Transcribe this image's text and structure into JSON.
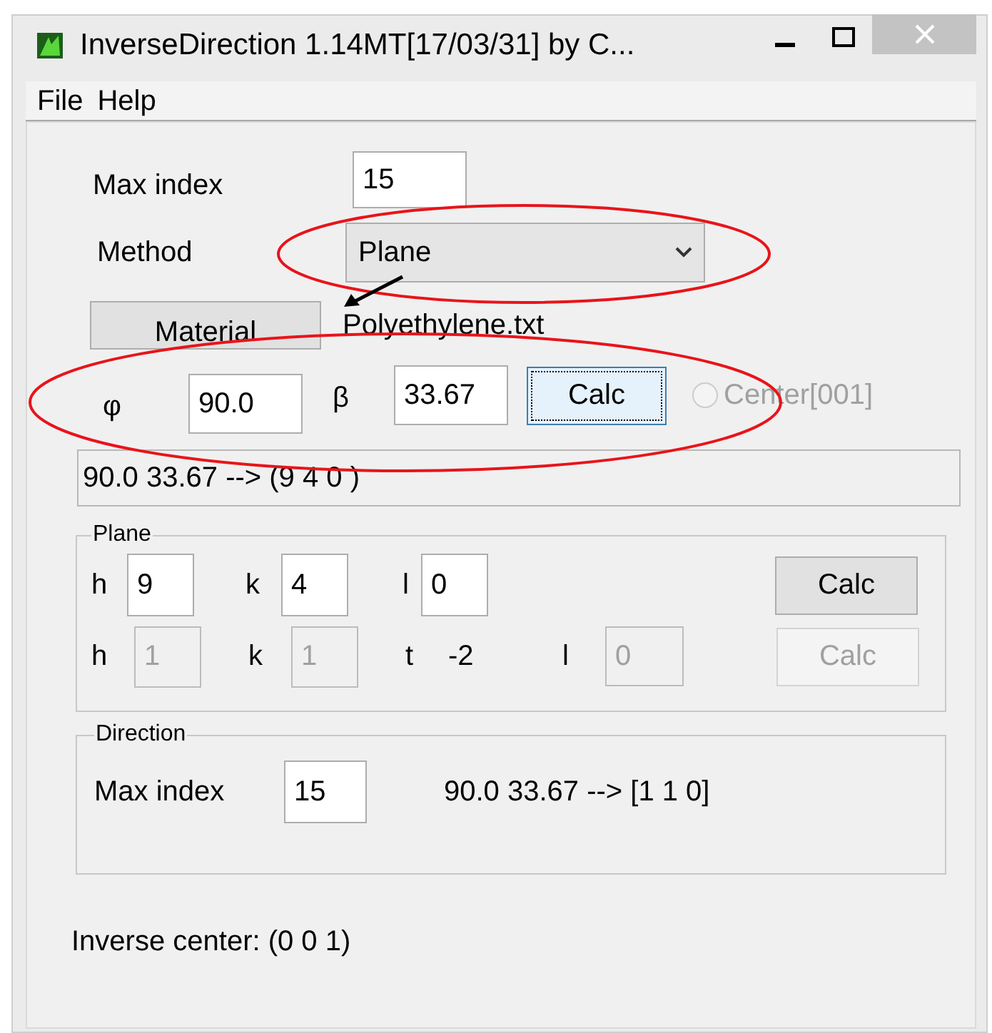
{
  "window": {
    "title": "InverseDirection 1.14MT[17/03/31] by C..."
  },
  "menu": [
    "File",
    "Help"
  ],
  "max_index": {
    "label": "Max index",
    "value": "15"
  },
  "method": {
    "label": "Method",
    "value": "Plane"
  },
  "material": {
    "button": "Material",
    "file": "Polyethylene.txt"
  },
  "angles": {
    "phi_label": "φ",
    "phi": "90.0",
    "beta_label": "β",
    "beta": "33.67",
    "calc": {
      "label": "Calc",
      "focused": true
    },
    "center": {
      "label": "Center[001]",
      "selected": false,
      "disabled": true
    }
  },
  "result": "90.0 33.67 --> (9 4 0 )",
  "plane": {
    "title": "Plane",
    "row_1": [
      {
        "label": "h",
        "value": "9",
        "disabled": false
      },
      {
        "label": "k",
        "value": "4",
        "disabled": false
      },
      {
        "label": "l",
        "value": "0",
        "disabled": false
      }
    ],
    "row_1_calc": {
      "label": "Calc",
      "disabled": false
    },
    "row_2": [
      {
        "label": "h",
        "value": "1",
        "disabled": true
      },
      {
        "label": "k",
        "value": "1",
        "disabled": true
      },
      {
        "label": "t",
        "text": "-2"
      },
      {
        "label": "l",
        "value": "0",
        "disabled": true
      }
    ],
    "row_2_calc": {
      "label": "Calc",
      "disabled": true
    }
  },
  "direction": {
    "title": "Direction",
    "label": "Max index",
    "value": "15",
    "result": "90.0 33.67 --> [1 1 0]"
  },
  "status": "Inverse center: (0 0 1)"
}
